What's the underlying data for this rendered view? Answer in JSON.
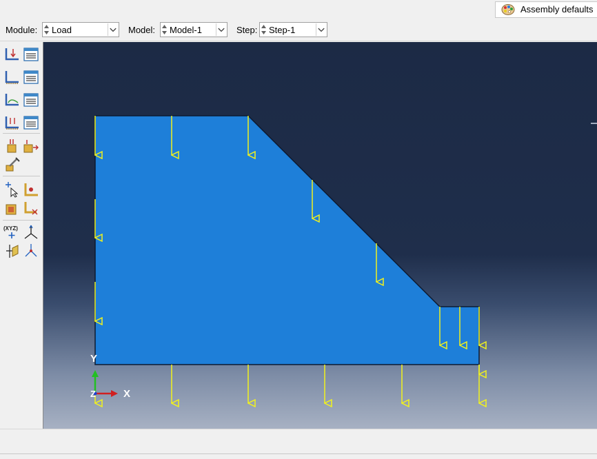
{
  "header": {
    "assembly_defaults_label": "Assembly defaults"
  },
  "context_bar": {
    "module_label": "Module:",
    "module_value": "Load",
    "model_label": "Model:",
    "model_value": "Model-1",
    "step_label": "Step:",
    "step_value": "Step-1"
  },
  "toolbox": {
    "tools": [
      "create-load-icon",
      "load-manager-icon",
      "create-bc-icon",
      "bc-manager-icon",
      "create-predefined-field-icon",
      "predefined-field-manager-icon",
      "create-load-case-icon",
      "load-case-manager-icon",
      "create-special-icon",
      "special-manager-icon",
      "amplitude-icon",
      "partition-query-icon",
      "set-icon",
      "surface-icon",
      "skin-icon",
      "datum-point-icon",
      "datum-axis-icon",
      "datum-plane-icon",
      "datum-csys-icon"
    ]
  },
  "viewport": {
    "triad": {
      "y_label": "Y",
      "x_label": "X",
      "z_label": "Z"
    },
    "part_color": "#1e7fd9",
    "load_arrow_color": "#f2f21c",
    "background_top": "#1c2a45",
    "background_bottom": "#a7b1c3"
  }
}
